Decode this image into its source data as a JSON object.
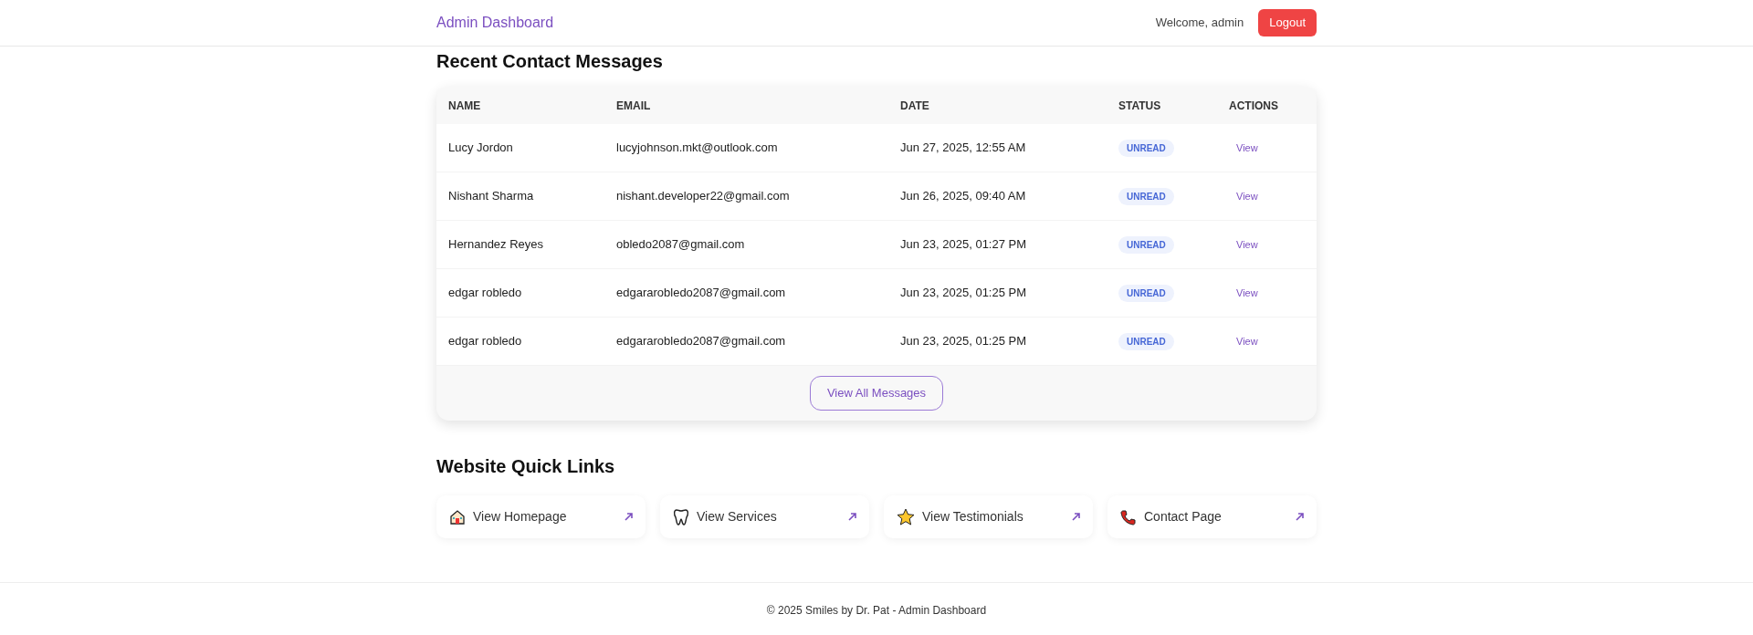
{
  "navbar": {
    "brand": "Admin Dashboard",
    "welcome": "Welcome, admin",
    "logout": "Logout"
  },
  "messages": {
    "title": "Recent Contact Messages",
    "columns": [
      "NAME",
      "EMAIL",
      "DATE",
      "STATUS",
      "ACTIONS"
    ],
    "rows": [
      {
        "name": "Lucy Jordon",
        "email": "lucyjohnson.mkt@outlook.com",
        "date": "Jun 27, 2025, 12:55 AM",
        "status": "UNREAD",
        "action": "View"
      },
      {
        "name": "Nishant Sharma",
        "email": "nishant.developer22@gmail.com",
        "date": "Jun 26, 2025, 09:40 AM",
        "status": "UNREAD",
        "action": "View"
      },
      {
        "name": "Hernandez Reyes",
        "email": "obledo2087@gmail.com",
        "date": "Jun 23, 2025, 01:27 PM",
        "status": "UNREAD",
        "action": "View"
      },
      {
        "name": "edgar robledo",
        "email": "edgararobledo2087@gmail.com",
        "date": "Jun 23, 2025, 01:25 PM",
        "status": "UNREAD",
        "action": "View"
      },
      {
        "name": "edgar robledo",
        "email": "edgararobledo2087@gmail.com",
        "date": "Jun 23, 2025, 01:25 PM",
        "status": "UNREAD",
        "action": "View"
      }
    ],
    "view_all": "View All Messages"
  },
  "quick_links": {
    "title": "Website Quick Links",
    "items": [
      {
        "kind": "home",
        "label": "View Homepage"
      },
      {
        "kind": "tooth",
        "label": "View Services"
      },
      {
        "kind": "star",
        "label": "View Testimonials"
      },
      {
        "kind": "phone",
        "label": "Contact Page"
      }
    ]
  },
  "footer": "© 2025 Smiles by Dr. Pat - Admin Dashboard"
}
